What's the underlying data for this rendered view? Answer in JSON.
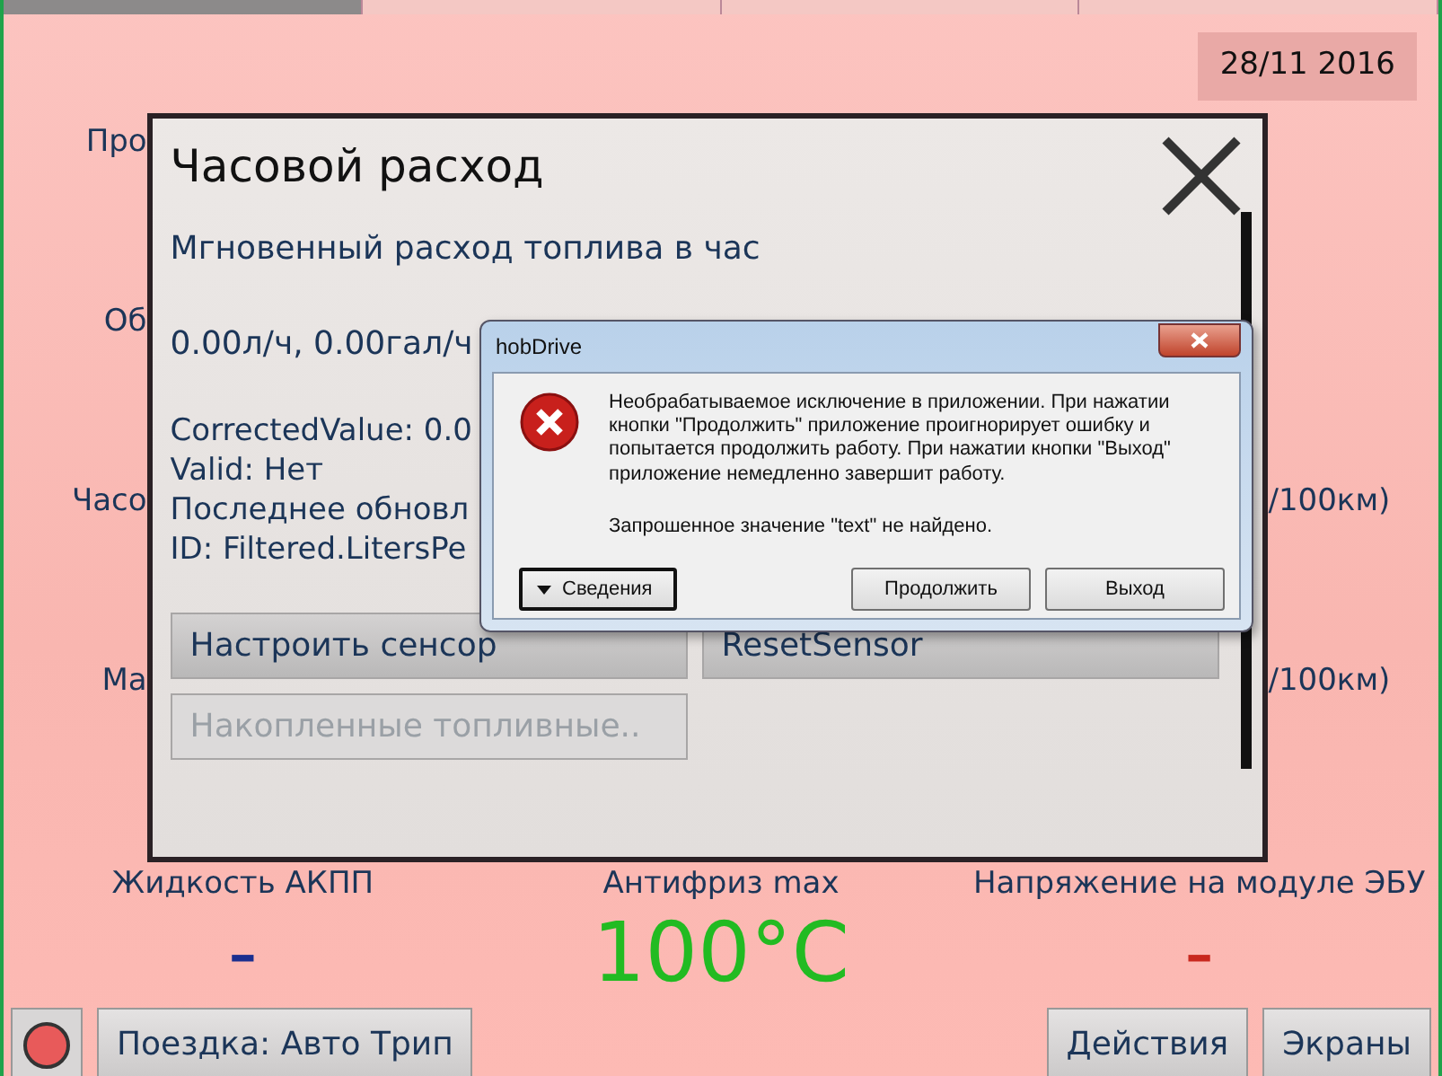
{
  "top_tabs": [
    {
      "selected": true
    },
    {
      "selected": false
    },
    {
      "selected": false
    },
    {
      "selected": false
    }
  ],
  "date": "28/11 2016",
  "background_rows": [
    {
      "left": "Про"
    },
    {
      "left": "Об"
    },
    {
      "left": "Часо",
      "right": "/100км)"
    },
    {
      "left": "Ма",
      "right": "/100км)"
    }
  ],
  "panel": {
    "title": "Часовой расход",
    "subtitle": "Мгновенный расход топлива в час",
    "reading": "0.00л/ч,  0.00гал/ч",
    "details": [
      "CorrectedValue: 0.0",
      "Valid: Нет",
      "Последнее обновл",
      "ID: Filtered.LitersPe"
    ],
    "buttons": [
      {
        "label": "Настроить сенсор",
        "disabled": false
      },
      {
        "label": "ResetSensor",
        "disabled": false
      },
      {
        "label": "Накопленные топливные..",
        "disabled": true
      }
    ]
  },
  "error_dialog": {
    "title": "hobDrive",
    "message": "Необрабатываемое исключение в приложении. При нажатии кнопки \"Продолжить\" приложение проигнорирует ошибку и попытается продолжить работу. При нажатии кнопки \"Выход\" приложение немедленно завершит работу.",
    "detail": "Запрошенное значение \"text\" не найдено.",
    "buttons": [
      {
        "label": "Сведения",
        "kind": "details",
        "focused": true
      },
      {
        "label": "Продолжить",
        "kind": "plain",
        "focused": false
      },
      {
        "label": "Выход",
        "kind": "plain",
        "focused": false
      }
    ]
  },
  "gauges": [
    {
      "label": "Жидкость АКПП",
      "value": "-",
      "color": "#1a2f8f"
    },
    {
      "label": "Антифриз max",
      "value": "100°C",
      "color": "#22bb22"
    },
    {
      "label": "Напряжение на модуле ЭБУ",
      "value": "-",
      "color": "#c8281e"
    }
  ],
  "bottom_bar": {
    "record_on": true,
    "trip": "Поездка: Авто Трип",
    "buttons": [
      "Действия",
      "Экраны"
    ]
  }
}
